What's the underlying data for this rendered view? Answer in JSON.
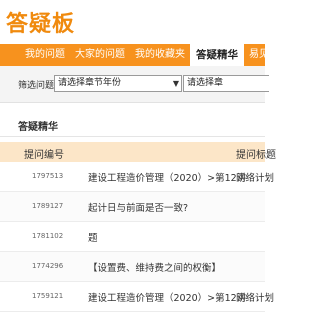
{
  "header": {
    "logo": "答疑板"
  },
  "nav": {
    "tabs": [
      {
        "label": "我的问题"
      },
      {
        "label": "大家的问题"
      },
      {
        "label": "我的收藏夹"
      },
      {
        "label": "答疑精华",
        "active": true
      },
      {
        "label": "易见问题"
      }
    ]
  },
  "filter": {
    "label": "筛选问题",
    "select1": "请选择章节年份",
    "select2": "请选择章"
  },
  "section": {
    "title": "答疑精华"
  },
  "table": {
    "headers": [
      "提问编号",
      "提问标题"
    ],
    "rows": [
      {
        "id": "1797513",
        "title": "建设工程造价管理（2020）>第12讲",
        "extra": "网络计划"
      },
      {
        "id": "1789127",
        "title": "起计日与前面是否一致?",
        "extra": ""
      },
      {
        "id": "1781102",
        "title": "题",
        "extra": ""
      },
      {
        "id": "1774296",
        "title": "【设置费、维持费之间的权衡】",
        "extra": ""
      },
      {
        "id": "1759121",
        "title": "建设工程造价管理（2020）>第12讲",
        "extra": "网络计划"
      }
    ]
  },
  "colors": {
    "accent": "#f7921e",
    "logo": "#f08a0e",
    "table_header": "#fce6c8"
  }
}
